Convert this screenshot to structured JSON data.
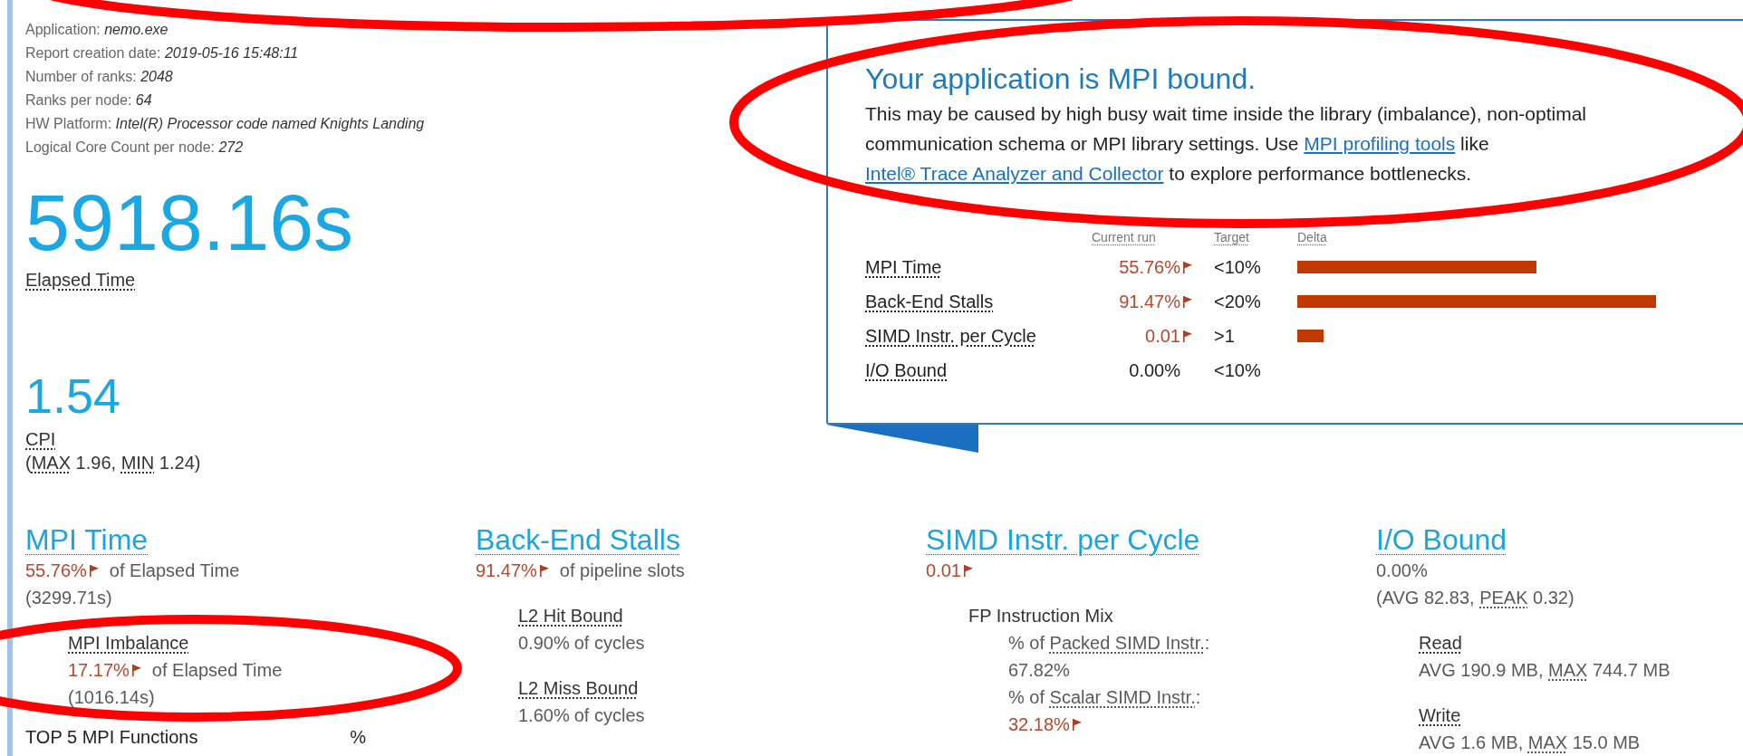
{
  "info": [
    {
      "label": "Application:",
      "value": "nemo.exe"
    },
    {
      "label": "Report creation date:",
      "value": "2019-05-16 15:48:11"
    },
    {
      "label": "Number of ranks:",
      "value": "2048"
    },
    {
      "label": "Ranks per node:",
      "value": "64"
    },
    {
      "label": "HW Platform:",
      "value": "Intel(R) Processor code named Knights Landing"
    },
    {
      "label": "Logical Core Count per node:",
      "value": "272"
    }
  ],
  "elapsed": {
    "value": "5918.16s",
    "label": "Elapsed Time"
  },
  "cpi": {
    "value": "1.54",
    "label": "CPI",
    "detail": [
      {
        "text": "(",
        "kind": "plain"
      },
      {
        "text": "MAX",
        "kind": "term"
      },
      {
        "text": " 1.96, ",
        "kind": "plain"
      },
      {
        "text": "MIN",
        "kind": "term"
      },
      {
        "text": " 1.24)",
        "kind": "plain"
      }
    ]
  },
  "summary": {
    "title": "Your application is MPI bound.",
    "message": [
      {
        "text": "This may be caused by high busy wait time inside the library (imbalance), non-optimal communication schema or MPI library settings. Use ",
        "kind": "plain"
      },
      {
        "text": "MPI profiling tools",
        "kind": "link"
      },
      {
        "text": " like ",
        "kind": "plain"
      },
      {
        "text": "Intel® Trace Analyzer and Collector",
        "kind": "link"
      },
      {
        "text": " to explore performance bottlenecks.",
        "kind": "plain"
      }
    ],
    "columns": [
      "Current run",
      "Target",
      "Delta"
    ],
    "rows": [
      {
        "metric": "MPI Time",
        "current": "55.76%",
        "flagged": true,
        "target": "<10%"
      },
      {
        "metric": "Back-End Stalls",
        "current": "91.47%",
        "flagged": true,
        "target": "<20%"
      },
      {
        "metric": "SIMD Instr. per Cycle",
        "current": "0.01",
        "flagged": true,
        "target": ">1"
      },
      {
        "metric": "I/O Bound",
        "current": "0.00%",
        "flagged": false,
        "target": "<10%"
      }
    ]
  },
  "metrics": [
    {
      "title": "MPI Time",
      "value": "55.76%",
      "flagged": true,
      "suffix": "of Elapsed Time",
      "lines": [
        [
          {
            "text": "(3299.71s)",
            "kind": "plain"
          }
        ]
      ],
      "subs": [
        {
          "title": "MPI Imbalance",
          "kind": "term",
          "value": "17.17%",
          "flagged": true,
          "suffix": "of Elapsed Time",
          "lines": [
            [
              {
                "text": "(1016.14s)",
                "kind": "plain"
              }
            ]
          ]
        }
      ],
      "table": {
        "columns": [
          "TOP 5 MPI Functions",
          "%"
        ]
      }
    },
    {
      "title": "Back-End Stalls",
      "value": "91.47%",
      "flagged": true,
      "suffix": "of pipeline slots",
      "subs": [
        {
          "title": "L2 Hit Bound",
          "kind": "term",
          "value": "0.90%",
          "flagged": false,
          "suffix": "of cycles"
        },
        {
          "title": "L2 Miss Bound",
          "kind": "term",
          "value": "1.60%",
          "flagged": false,
          "suffix": "of cycles"
        }
      ]
    },
    {
      "title": "SIMD Instr. per Cycle",
      "value": "0.01",
      "flagged": true,
      "subs": [
        {
          "title": "FP Instruction Mix",
          "kind": "group",
          "items": [
            {
              "label": [
                {
                  "text": "% of ",
                  "kind": "plain"
                },
                {
                  "text": "Packed SIMD Instr.",
                  "kind": "term"
                },
                {
                  "text": ":",
                  "kind": "plain"
                }
              ],
              "value": "67.82%",
              "flagged": false
            },
            {
              "label": [
                {
                  "text": "% of ",
                  "kind": "plain"
                },
                {
                  "text": "Scalar SIMD Instr.",
                  "kind": "term"
                },
                {
                  "text": ":",
                  "kind": "plain"
                }
              ],
              "value": "32.18%",
              "flagged": true
            }
          ]
        }
      ]
    },
    {
      "title": "I/O Bound",
      "value": "0.00%",
      "flagged": false,
      "lines": [
        [
          {
            "text": "(AVG 82.83, ",
            "kind": "plain"
          },
          {
            "text": "PEAK",
            "kind": "term"
          },
          {
            "text": " 0.32)",
            "kind": "plain"
          }
        ]
      ],
      "subs": [
        {
          "title": "Read",
          "kind": "term",
          "lines": [
            [
              {
                "text": "AVG 190.9 MB, ",
                "kind": "plain"
              },
              {
                "text": "MAX",
                "kind": "term"
              },
              {
                "text": " 744.7 MB",
                "kind": "plain"
              }
            ]
          ]
        },
        {
          "title": "Write",
          "kind": "term",
          "lines": [
            [
              {
                "text": "AVG 1.6 MB, ",
                "kind": "plain"
              },
              {
                "text": "MAX",
                "kind": "term"
              },
              {
                "text": " 15.0 MB",
                "kind": "plain"
              }
            ]
          ]
        }
      ]
    }
  ],
  "highlights": [
    {
      "kind": "ellipse"
    },
    {
      "kind": "ellipse"
    },
    {
      "kind": "ellipse"
    }
  ]
}
